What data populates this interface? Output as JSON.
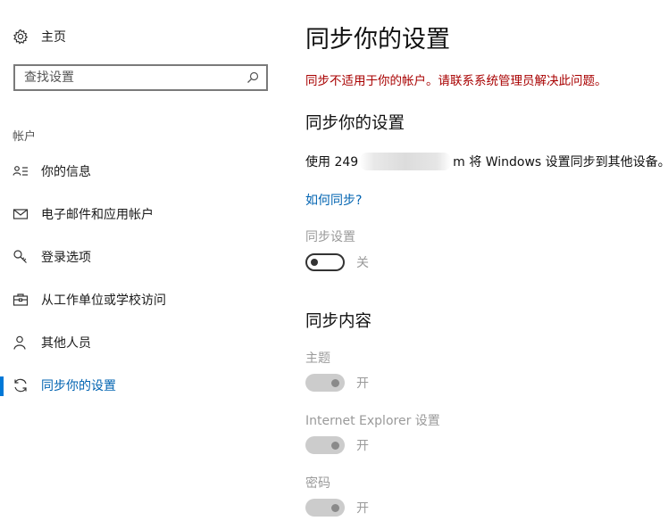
{
  "sidebar": {
    "home_label": "主页",
    "search_placeholder": "查找设置",
    "section_label": "帐户",
    "items": [
      {
        "label": "你的信息",
        "icon": "person-info-icon"
      },
      {
        "label": "电子邮件和应用帐户",
        "icon": "mail-icon"
      },
      {
        "label": "登录选项",
        "icon": "key-icon"
      },
      {
        "label": "从工作单位或学校访问",
        "icon": "briefcase-icon"
      },
      {
        "label": "其他人员",
        "icon": "person-icon"
      },
      {
        "label": "同步你的设置",
        "icon": "sync-icon",
        "active": true
      }
    ]
  },
  "main": {
    "title": "同步你的设置",
    "error": "同步不适用于你的帐户。请联系系统管理员解决此问题。",
    "section_title": "同步你的设置",
    "using_prefix": "使用 249",
    "using_suffix": "m 将 Windows 设置同步到其他设备。",
    "how_link": "如何同步?",
    "sync_settings_label": "同步设置",
    "sync_settings_state": "关",
    "content_title": "同步内容",
    "content_items": [
      {
        "label": "主题",
        "state": "开"
      },
      {
        "label": "Internet Explorer 设置",
        "state": "开"
      },
      {
        "label": "密码",
        "state": "开"
      }
    ]
  },
  "colors": {
    "accent": "#0078d7",
    "link": "#0063b1",
    "error": "#a80000",
    "disabled_text": "#9a9a9a",
    "disabled_toggle": "#cccccc"
  }
}
